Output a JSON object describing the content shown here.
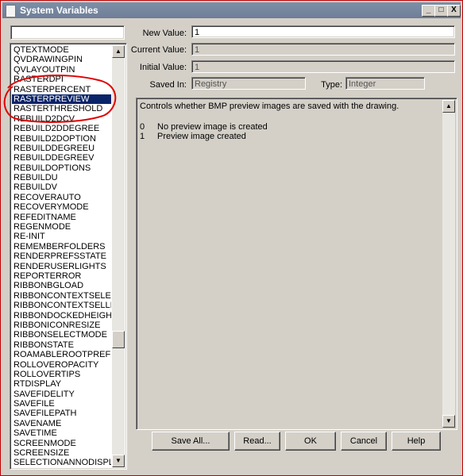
{
  "window": {
    "title": "System Variables",
    "controls": {
      "minimize": "_",
      "maximize": "□",
      "close": "X"
    }
  },
  "search": {
    "value": ""
  },
  "variables": [
    "QTEXTMODE",
    "QVDRAWINGPIN",
    "QVLAYOUTPIN",
    "RASTERDPI",
    "RASTERPERCENT",
    "RASTERPREVIEW",
    "RASTERTHRESHOLD",
    "REBUILD2DCV",
    "REBUILD2DDEGREE",
    "REBUILD2DOPTION",
    "REBUILDDEGREEU",
    "REBUILDDEGREEV",
    "REBUILDOPTIONS",
    "REBUILDU",
    "REBUILDV",
    "RECOVERAUTO",
    "RECOVERYMODE",
    "REFEDITNAME",
    "REGENMODE",
    "RE-INIT",
    "REMEMBERFOLDERS",
    "RENDERPREFSSTATE",
    "RENDERUSERLIGHTS",
    "REPORTERROR",
    "RIBBONBGLOAD",
    "RIBBONCONTEXTSELECT",
    "RIBBONCONTEXTSELLIM",
    "RIBBONDOCKEDHEIGHT",
    "RIBBONICONRESIZE",
    "RIBBONSELECTMODE",
    "RIBBONSTATE",
    "ROAMABLEROOTPREFIX",
    "ROLLOVEROPACITY",
    "ROLLOVERTIPS",
    "RTDISPLAY",
    "SAVEFIDELITY",
    "SAVEFILE",
    "SAVEFILEPATH",
    "SAVENAME",
    "SAVETIME",
    "SCREENMODE",
    "SCREENSIZE",
    "SELECTIONANNODISPLAY"
  ],
  "selected_variable": "RASTERPREVIEW",
  "fields": {
    "new_value_label": "New Value:",
    "new_value": "1",
    "current_value_label": "Current Value:",
    "current_value": "1",
    "initial_value_label": "Initial Value:",
    "initial_value": "1",
    "saved_in_label": "Saved In:",
    "saved_in": "Registry",
    "type_label": "Type:",
    "type": "Integer"
  },
  "description": {
    "text": "Controls whether BMP preview images are saved with the drawing.",
    "options": [
      {
        "key": "0",
        "text": "No preview image is created"
      },
      {
        "key": "1",
        "text": "Preview image created"
      }
    ]
  },
  "buttons": {
    "save_all": "Save All...",
    "read": "Read...",
    "ok": "OK",
    "cancel": "Cancel",
    "help": "Help"
  },
  "colors": {
    "selection": "#0a246a",
    "annotation": "#e00000",
    "titlebar": "#7384a0"
  }
}
